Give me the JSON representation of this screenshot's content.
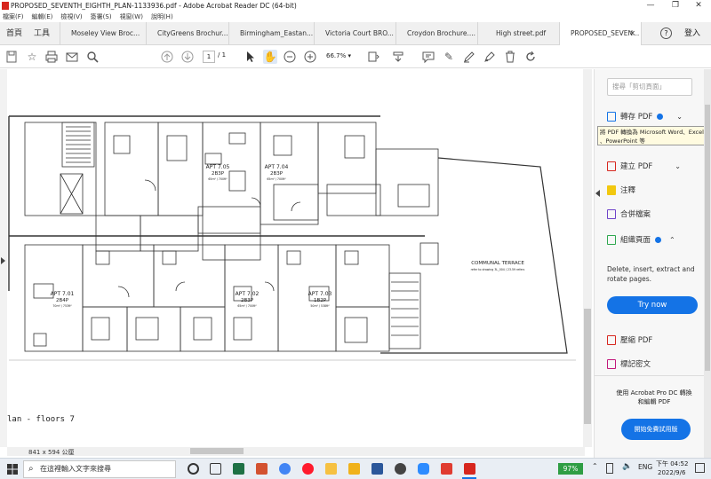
{
  "window": {
    "title": "PROPOSED_SEVENTH_EIGHTH_PLAN-1133936.pdf - Adobe Acrobat Reader DC (64-bit)",
    "controls": [
      "—",
      "❐",
      "✕"
    ]
  },
  "menu": [
    "檔案(F)",
    "編輯(E)",
    "檢視(V)",
    "簽署(S)",
    "視窗(W)",
    "說明(H)"
  ],
  "tabs": {
    "home": "首頁",
    "tools": "工具",
    "docs": [
      "Moseley View Broc...",
      "CityGreens Brochur...",
      "Birmingham_Eastan...",
      "Victoria Court BRO...",
      "Croydon Brochure....",
      "High street.pdf",
      "PROPOSED_SEVEN..."
    ],
    "close": "✕",
    "help": "?",
    "login": "登入"
  },
  "toolbar": {
    "page_current": "1",
    "page_total": "/ 1",
    "zoom": "66.7%"
  },
  "plan": {
    "units": [
      {
        "name": "APT 7.05",
        "type": "2B3P",
        "area": "65m² / 700ft²"
      },
      {
        "name": "APT 7.04",
        "type": "2B3P",
        "area": "65m² / 700ft²"
      },
      {
        "name": "APT 7.01",
        "type": "2B4P",
        "area": "70m² / 753ft²"
      },
      {
        "name": "APT 7.02",
        "type": "2B3P",
        "area": "65m² / 700ft²"
      },
      {
        "name": "APT 7.03",
        "type": "1B2P",
        "area": "50m² / 538ft²"
      }
    ],
    "terrace_label": "COMMUNAL TERRACE",
    "terrace_sub": "refer to drawing 3L_004 / 23.59 refers",
    "caption": "lan - floors 7"
  },
  "status": {
    "page_size": "841 x 594 公厘"
  },
  "rightpane": {
    "search_placeholder": "搜尋「剪切頁面」",
    "export_pdf": "轉存 PDF",
    "tooltip": "將 PDF 轉換為 Microsoft Word、Excel 、PowerPoint 等",
    "create_pdf": "建立 PDF",
    "comment": "注釋",
    "combine": "合併檔案",
    "organize": "組織頁面",
    "organize_desc": "Delete, insert, extract and rotate pages.",
    "try_now": "Try now",
    "compress": "壓縮 PDF",
    "redact": "標記密文",
    "promo": "使用 Acrobat Pro DC 轉換和編輯 PDF",
    "trial": "開始免費試用版"
  },
  "taskbar": {
    "search_placeholder": "在這裡輸入文字來搜尋",
    "battery": "97%",
    "lang": "ENG",
    "time": "下午 04:52",
    "date": "2022/9/6"
  },
  "colors": {
    "accent_blue": "#1473e6",
    "acrobat_red": "#d7261e",
    "battery_green": "#2f9e44"
  }
}
